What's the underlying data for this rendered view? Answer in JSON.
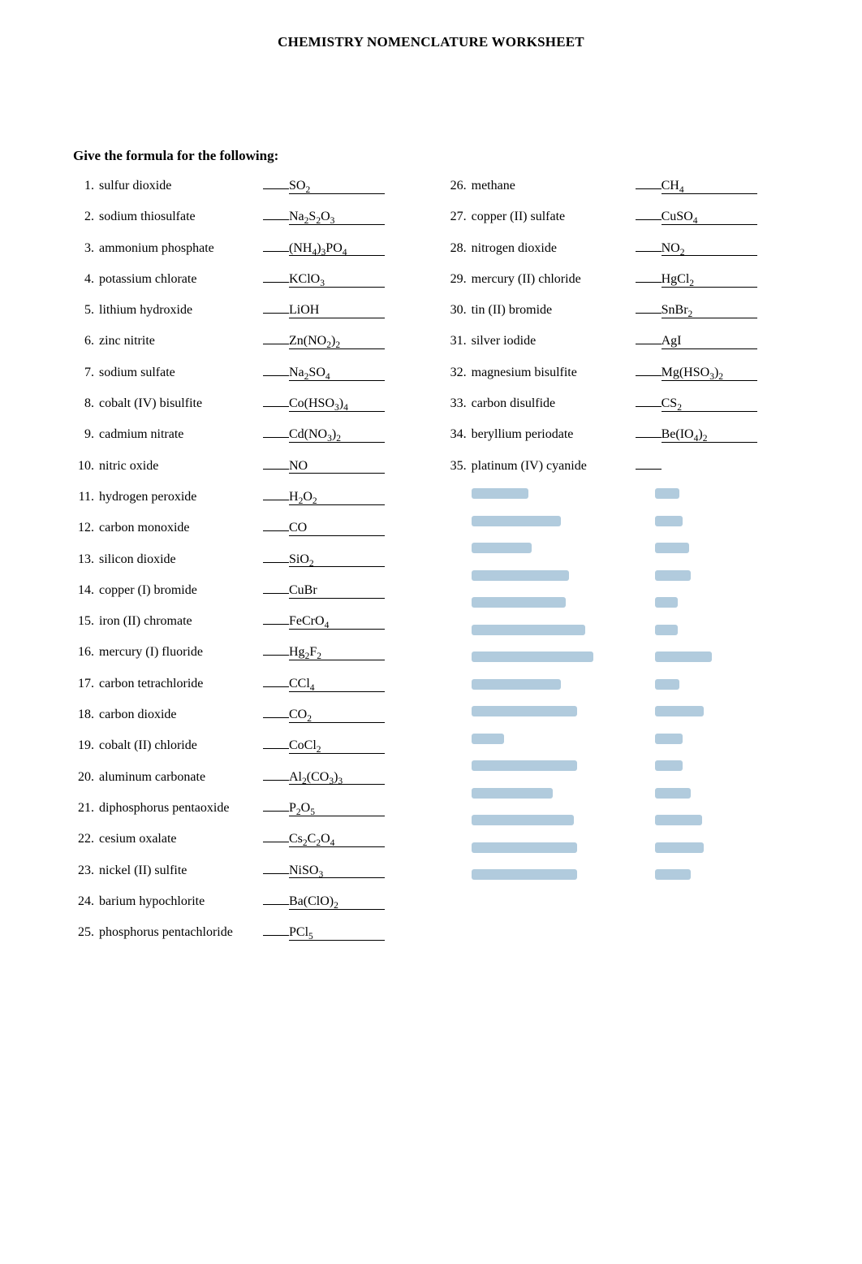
{
  "title": "CHEMISTRY NOMENCLATURE WORKSHEET",
  "section_label": "Give the formula for the following:",
  "left": [
    {
      "n": "1.",
      "name": "sulfur dioxide",
      "formula": "SO<sub>2</sub>"
    },
    {
      "n": "2.",
      "name": "sodium thiosulfate",
      "formula": "Na<sub>2</sub>S<sub>2</sub>O<sub>3</sub>"
    },
    {
      "n": "3.",
      "name": "ammonium phosphate",
      "formula": "(NH<sub>4</sub>)<sub>3</sub>PO<sub>4</sub>"
    },
    {
      "n": "4.",
      "name": "potassium chlorate",
      "formula": "KClO<sub>3</sub>"
    },
    {
      "n": "5.",
      "name": "lithium hydroxide",
      "formula": "LiOH"
    },
    {
      "n": "6.",
      "name": "zinc nitrite",
      "formula": "Zn(NO<sub>2</sub>)<sub>2</sub>"
    },
    {
      "n": "7.",
      "name": "sodium sulfate",
      "formula": "Na<sub>2</sub>SO<sub>4</sub>"
    },
    {
      "n": "8.",
      "name": "cobalt (IV) bisulfite",
      "formula": "Co(HSO<sub>3</sub>)<sub>4</sub>"
    },
    {
      "n": "9.",
      "name": "cadmium nitrate",
      "formula": "Cd(NO<sub>3</sub>)<sub>2</sub>"
    },
    {
      "n": "10.",
      "name": "nitric oxide",
      "formula": "NO"
    },
    {
      "n": "11.",
      "name": "hydrogen peroxide",
      "formula": "H<sub>2</sub>O<sub>2</sub>"
    },
    {
      "n": "12.",
      "name": "carbon monoxide",
      "formula": "CO"
    },
    {
      "n": "13.",
      "name": "silicon dioxide",
      "formula": "SiO<sub>2</sub>"
    },
    {
      "n": "14.",
      "name": "copper (I) bromide",
      "formula": "CuBr"
    },
    {
      "n": "15.",
      "name": "iron (II) chromate",
      "formula": "FeCrO<sub>4</sub>"
    },
    {
      "n": "16.",
      "name": "mercury (I) fluoride",
      "formula": "Hg<sub>2</sub>F<sub>2</sub>"
    },
    {
      "n": "17.",
      "name": "carbon tetrachloride",
      "formula": "CCl<sub>4</sub>"
    },
    {
      "n": "18.",
      "name": "carbon dioxide",
      "formula": "CO<sub>2</sub>"
    },
    {
      "n": "19.",
      "name": "cobalt (II) chloride",
      "formula": "CoCl<sub>2</sub>"
    },
    {
      "n": "20.",
      "name": "aluminum carbonate",
      "formula": "Al<sub>2</sub>(CO<sub>3</sub>)<sub>3</sub>"
    },
    {
      "n": "21.",
      "name": "diphosphorus  pentaoxide",
      "formula": "P<sub>2</sub>O<sub>5</sub>"
    },
    {
      "n": "22.",
      "name": "cesium oxalate",
      "formula": "Cs<sub>2</sub>C<sub>2</sub>O<sub>4</sub>"
    },
    {
      "n": "23.",
      "name": "nickel (II) sulfite",
      "formula": "NiSO<sub>3</sub>"
    },
    {
      "n": "24.",
      "name": "barium hypochlorite",
      "formula": "Ba(ClO)<sub>2</sub>"
    },
    {
      "n": "25.",
      "name": "phosphorus pentachloride",
      "formula": "PCl<sub>5</sub>"
    }
  ],
  "right": [
    {
      "n": "26.",
      "name": "methane",
      "formula": "CH<sub>4</sub>"
    },
    {
      "n": "27.",
      "name": "copper (II) sulfate",
      "formula": "CuSO<sub>4</sub>"
    },
    {
      "n": "28.",
      "name": "nitrogen dioxide",
      "formula": "NO<sub>2</sub>"
    },
    {
      "n": "29.",
      "name": "mercury (II) chloride",
      "formula": "HgCl<sub>2</sub>"
    },
    {
      "n": "30.",
      "name": "tin (II) bromide",
      "formula": "SnBr<sub>2</sub>"
    },
    {
      "n": "31.",
      "name": "silver iodide",
      "formula": "AgI"
    },
    {
      "n": "32.",
      "name": "magnesium bisulfite",
      "formula": "Mg(HSO<sub>3</sub>)<sub>2</sub>"
    },
    {
      "n": "33.",
      "name": "carbon disulfide",
      "formula": "CS<sub>2</sub>"
    },
    {
      "n": "34.",
      "name": "beryllium periodate",
      "formula": "Be(IO<sub>4</sub>)<sub>2</sub>"
    },
    {
      "n": "35.",
      "name": "platinum (IV) cyanide",
      "formula": "",
      "hidden_formula": true
    },
    {
      "hidden_all": true,
      "nw": 70,
      "fw": 30
    },
    {
      "hidden_all": true,
      "nw": 110,
      "fw": 34
    },
    {
      "hidden_all": true,
      "nw": 74,
      "fw": 42
    },
    {
      "hidden_all": true,
      "nw": 120,
      "fw": 44
    },
    {
      "hidden_all": true,
      "nw": 116,
      "fw": 28
    },
    {
      "hidden_all": true,
      "nw": 140,
      "fw": 28
    },
    {
      "hidden_all": true,
      "nw": 150,
      "fw": 70
    },
    {
      "hidden_all": true,
      "nw": 110,
      "fw": 30
    },
    {
      "hidden_all": true,
      "nw": 130,
      "fw": 60
    },
    {
      "hidden_all": true,
      "nw": 40,
      "fw": 34
    },
    {
      "hidden_all": true,
      "nw": 130,
      "fw": 34
    },
    {
      "hidden_all": true,
      "nw": 100,
      "fw": 44
    },
    {
      "hidden_all": true,
      "nw": 126,
      "fw": 58
    },
    {
      "hidden_all": true,
      "nw": 130,
      "fw": 60
    },
    {
      "hidden_all": true,
      "nw": 130,
      "fw": 44
    }
  ]
}
